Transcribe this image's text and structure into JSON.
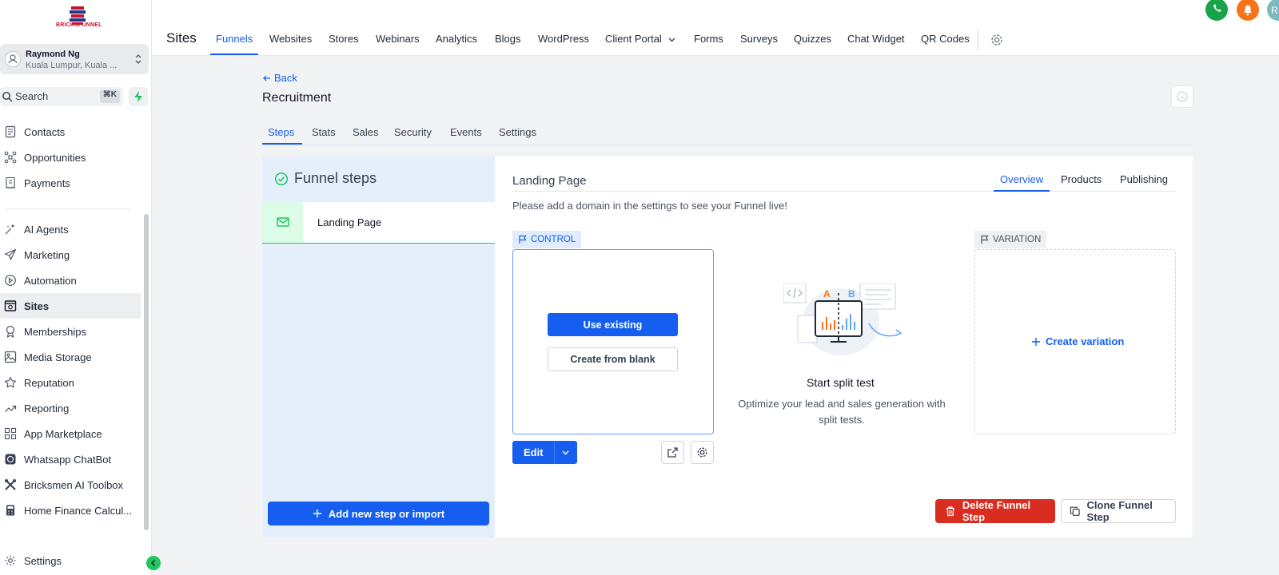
{
  "brand": {
    "name": "BRICKSFUNNEL"
  },
  "account": {
    "name": "Raymond Ng",
    "location": "Kuala Lumpur, Kuala ..."
  },
  "search": {
    "label": "Search",
    "shortcut": "⌘K"
  },
  "sidebar": {
    "items": [
      {
        "label": "Contacts",
        "icon": "contacts-icon"
      },
      {
        "label": "Opportunities",
        "icon": "opportunities-icon"
      },
      {
        "label": "Payments",
        "icon": "payments-icon"
      },
      {
        "label": "AI Agents",
        "icon": "ai-agents-icon"
      },
      {
        "label": "Marketing",
        "icon": "send-icon"
      },
      {
        "label": "Automation",
        "icon": "automation-icon"
      },
      {
        "label": "Sites",
        "icon": "sites-icon",
        "active": true
      },
      {
        "label": "Memberships",
        "icon": "award-icon"
      },
      {
        "label": "Media Storage",
        "icon": "image-icon"
      },
      {
        "label": "Reputation",
        "icon": "star-icon"
      },
      {
        "label": "Reporting",
        "icon": "trend-icon"
      },
      {
        "label": "App Marketplace",
        "icon": "grid-icon"
      },
      {
        "label": "Whatsapp ChatBot",
        "icon": "whatsapp-icon"
      },
      {
        "label": "Bricksmen AI Toolbox",
        "icon": "tools-icon"
      },
      {
        "label": "Home Finance Calcul...",
        "icon": "calculator-icon"
      }
    ],
    "settings_label": "Settings"
  },
  "topbar": {
    "title": "Sites",
    "tabs": [
      "Funnels",
      "Websites",
      "Stores",
      "Webinars",
      "Analytics",
      "Blogs",
      "WordPress",
      "Client Portal",
      "Forms",
      "Surveys",
      "Quizzes",
      "Chat Widget",
      "QR Codes"
    ],
    "active_tab": "Funnels",
    "avatar_initials": "R"
  },
  "page": {
    "back_label": "Back",
    "title": "Recruitment",
    "tabs": [
      "Steps",
      "Stats",
      "Sales",
      "Security",
      "Events",
      "Settings"
    ],
    "active_tab": "Steps"
  },
  "steps": {
    "heading": "Funnel steps",
    "items": [
      {
        "label": "Landing Page"
      }
    ],
    "add_label": "Add new step or import"
  },
  "detail": {
    "title": "Landing Page",
    "tabs": [
      "Overview",
      "Products",
      "Publishing"
    ],
    "active_tab": "Overview",
    "notice": "Please add a domain in the settings to see your Funnel live!",
    "control_label": "CONTROL",
    "variation_label": "VARIATION",
    "use_existing": "Use existing",
    "create_blank": "Create from blank",
    "edit_label": "Edit",
    "split_title": "Start split test",
    "split_desc": "Optimize your lead and sales generation with split tests.",
    "create_variation": "Create variation",
    "illus_a": "A",
    "illus_b": "B",
    "delete_label": "Delete Funnel Step",
    "clone_label": "Clone Funnel Step"
  },
  "colors": {
    "accent": "#155eef",
    "success": "#22c55e",
    "danger": "#d92d20",
    "brand": "#c8102e"
  }
}
